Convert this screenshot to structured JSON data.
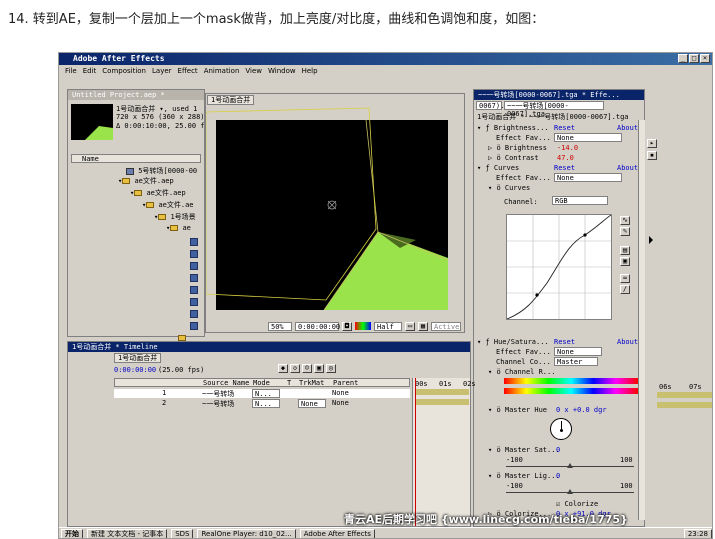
{
  "heading": "14. 转到AE，复制一个层加上一个mask做背，加上亮度/对比度，曲线和色调饱和度，如图：",
  "app": {
    "title": "Adobe After Effects",
    "menu": [
      "File",
      "Edit",
      "Composition",
      "Layer",
      "Effect",
      "Animation",
      "View",
      "Window",
      "Help"
    ]
  },
  "project": {
    "title": "Untitled Project.aep *",
    "comp_name": "1号动画合并 ▾, used 1",
    "comp_size": "720 x 576  (360 x 288)",
    "comp_duration": "Δ 0:00:10:00, 25.00 fp",
    "col_name": "Name",
    "items": [
      "5号转场[0000-00",
      "ae文件.aep",
      "ae文件.aep",
      "ae文件.ae",
      "1号场景",
      "ae"
    ]
  },
  "comp": {
    "tab": "1号动画合并",
    "zoom": "50%",
    "timecode": "0:00:00:00",
    "resolution": "Half",
    "active": "Active"
  },
  "timeline": {
    "title": "1号动画合并 * Timeline",
    "tab": "1号动画合并",
    "timecode": "0:00:00:00",
    "fps": "(25.00 fps)",
    "cols": {
      "source": "Source Name",
      "mode": "Mode",
      "t": "T",
      "trkmat": "TrkMat",
      "parent": "Parent"
    },
    "layers": [
      {
        "num": "1",
        "name": "~一号转场",
        "mode": "N...",
        "trkmat": "",
        "parent": "None"
      },
      {
        "num": "2",
        "name": "~一号转场",
        "mode": "N...",
        "trkmat": "None",
        "parent": "None"
      }
    ],
    "ruler": [
      "00s",
      "01s",
      "02s",
      "06s",
      "07s"
    ]
  },
  "effects": {
    "title": "~~一号转场[0000-0067].tga * Effe...",
    "tab1": "0067).tga",
    "tab2": "~~一号转场[0000-0067].tga",
    "subtitle": "1号动画合并 * ~~一号转场[0000-0067].tga",
    "reset": "Reset",
    "about": "About",
    "effect_fav": "Effect Fav...",
    "none": "None",
    "brightness_contrast": {
      "name": "Brightness...",
      "brightness_label": "Brightness",
      "brightness_value": "-14.0",
      "contrast_label": "Contrast",
      "contrast_value": "47.0"
    },
    "curves": {
      "name": "Curves",
      "sub": "Curves",
      "channel_label": "Channel:",
      "channel_value": "RGB"
    },
    "hue": {
      "name": "Hue/Satura...",
      "channel_co": "Channel Co...",
      "channel_co_value": "Master",
      "channel_r": "Channel R...",
      "master_hue_label": "Master Hue",
      "master_hue_value": "0 x +0.0 dgr",
      "master_sat_label": "Master Sat...",
      "master_sat_value": "0",
      "sat_min": "-100",
      "sat_max": "100",
      "master_lig_label": "Master Lig...",
      "master_lig_value": "0",
      "lig_min": "-100",
      "lig_max": "100",
      "colorize_label": "Colorize",
      "colorize2_label": "Colorize...",
      "colorize_value": "0 x +91.0 dgr"
    }
  },
  "taskbar": {
    "start": "开始",
    "items": [
      "新建 文本文档 - 记事本",
      "SDS",
      "RealOne Player: d10_02...",
      "Adobe After Effects"
    ],
    "clock": "23:28"
  },
  "watermark": "青云AE后期学习吧   {www.linecg.com/tieba/1775}",
  "colors": {
    "accent": "#0a246a",
    "green_shape": "#9be34a",
    "canvas": "#000000"
  }
}
